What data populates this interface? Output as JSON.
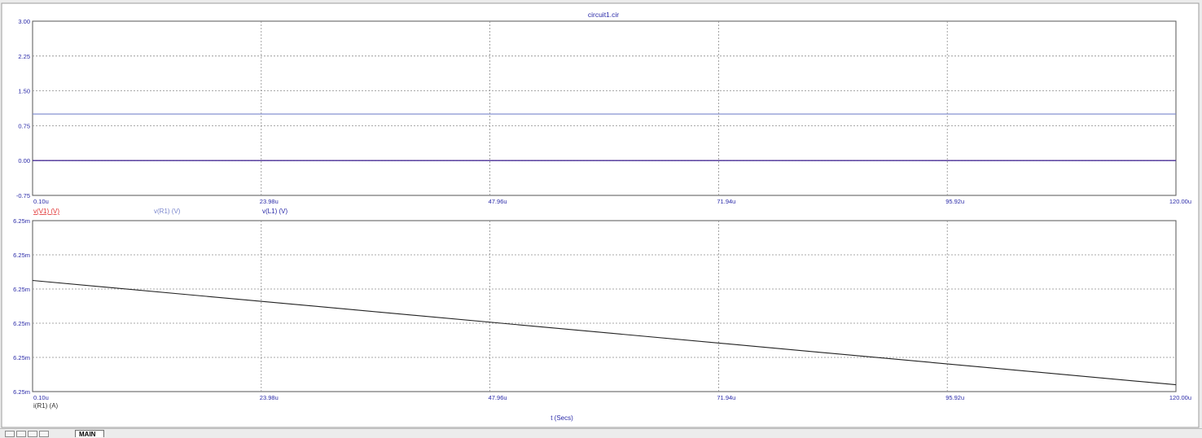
{
  "chart_data": [
    {
      "type": "line",
      "title": "circuit1.cir",
      "x_tick_labels": [
        "0.10u",
        "23.98u",
        "47.96u",
        "71.94u",
        "95.92u",
        "120.00u"
      ],
      "xlim": [
        0.1,
        120.0
      ],
      "y_tick_labels": [
        "3.00",
        "2.25",
        "1.50",
        "0.75",
        "0.00",
        "-0.75"
      ],
      "ylim": [
        -0.75,
        3.0
      ],
      "grid": true,
      "legend": [
        "v(V1) (V)",
        "v(R1) (V)",
        "v(L1) (V)"
      ],
      "series": [
        {
          "name": "v(V1) (V)",
          "color": "#e03030",
          "x": [
            0.1,
            120.0
          ],
          "y": [
            0.0,
            0.0
          ]
        },
        {
          "name": "v(R1) (V)",
          "color": "#7a86cc",
          "x": [
            0.1,
            120.0
          ],
          "y": [
            1.0,
            1.0
          ]
        },
        {
          "name": "v(L1) (V)",
          "color": "#2a2aa8",
          "x": [
            0.1,
            120.0
          ],
          "y": [
            0.0,
            0.0
          ]
        }
      ]
    },
    {
      "type": "line",
      "x_tick_labels": [
        "0.10u",
        "23.98u",
        "47.96u",
        "71.94u",
        "95.92u",
        "120.00u"
      ],
      "xlim": [
        0.1,
        120.0
      ],
      "y_tick_labels": [
        "6.25m",
        "6.25m",
        "6.25m",
        "6.25m",
        "6.25m",
        "6.25m"
      ],
      "ylim": [
        0.0,
        1.0
      ],
      "grid": true,
      "legend": [
        "i(R1) (A)"
      ],
      "xlabel": "t (Secs)",
      "series": [
        {
          "name": "i(R1) (A)",
          "color": "#222222",
          "x": [
            0.1,
            120.0
          ],
          "y": [
            0.65,
            0.04
          ]
        }
      ]
    }
  ],
  "tabs": {
    "active_label": "MAIN"
  }
}
